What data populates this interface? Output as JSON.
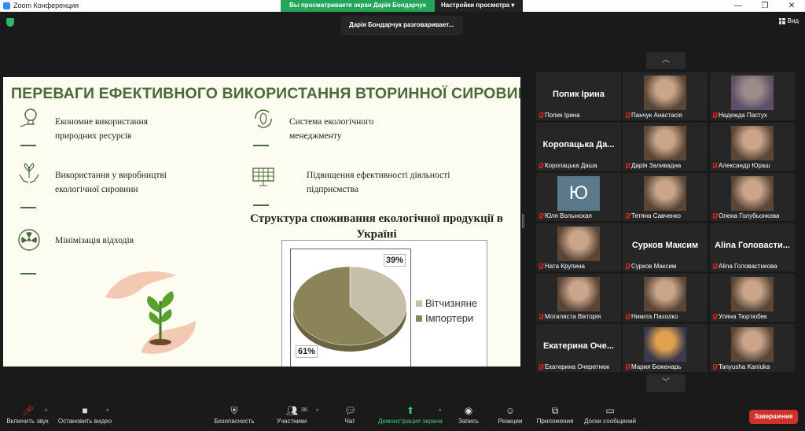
{
  "window": {
    "title": "Zoom Конференция",
    "controls": [
      "minimize",
      "maximize",
      "close"
    ]
  },
  "viewing_bar": {
    "viewing_text": "Вы просматриваете экран Дарія Бондарчук",
    "view_options": "Настройки просмотра"
  },
  "view_button": {
    "label": "Вид"
  },
  "tooltip": {
    "text": "Дарія Бондарчук разговаривает..."
  },
  "slide": {
    "title": "ПЕРЕВАГИ ЕФЕКТИВНОГО ВИКОРИСТАННЯ ВТОРИННОЇ СИРОВИНИ",
    "features_left": [
      {
        "icon": "lightbulb-icon",
        "text": "Економне використання природних ресурсів"
      },
      {
        "icon": "hands-plant-icon",
        "text": "Використання у виробництві екологічної сировини"
      },
      {
        "icon": "radiation-icon",
        "text": "Мінімізація відходів"
      }
    ],
    "features_right": [
      {
        "icon": "recycle-leaf-icon",
        "text": "Система екологічного менеджменту"
      },
      {
        "icon": "solar-panel-icon",
        "text": "Підвищення ефективності діяльності підприємства"
      }
    ],
    "chart_title": "Структура споживання екологічної продукції в Україні"
  },
  "chart_data": {
    "type": "pie",
    "title": "Структура споживання екологічної продукції в Україні",
    "categories": [
      "Вітчизняне",
      "Імпортери"
    ],
    "values": [
      39,
      61
    ],
    "labels": [
      "39%",
      "61%"
    ],
    "colors": [
      "#c5bfa9",
      "#8b8458"
    ],
    "legend": "right"
  },
  "gallery": {
    "up_icon": "chevron-up-icon",
    "down_icon": "chevron-down-icon",
    "tiles": [
      {
        "name": "Попик Ірина",
        "big": "Попик Ірина",
        "video": false
      },
      {
        "name": "Панчук Анастасія",
        "big": "",
        "video": true,
        "photo": "person-photo"
      },
      {
        "name": "Надежда Пастух",
        "big": "",
        "video": true,
        "photo": "building-photo"
      },
      {
        "name": "Коропацька Даша",
        "big": "Коропацька Да...",
        "video": false
      },
      {
        "name": "Дарія Заливадна",
        "big": "",
        "video": true,
        "photo": "person-photo"
      },
      {
        "name": "Александр Юраш",
        "big": "",
        "video": true,
        "photo": "person-photo"
      },
      {
        "name": "Юля Волынская",
        "big": "",
        "video": false,
        "avatar": "Ю"
      },
      {
        "name": "Тетяна Савченко",
        "big": "",
        "video": true,
        "photo": "person-photo"
      },
      {
        "name": "Олена Голубьонкова",
        "big": "",
        "video": true,
        "photo": "person-photo"
      },
      {
        "name": "Ната Крупина",
        "big": "",
        "video": true,
        "photo": "person-photo"
      },
      {
        "name": "Сурков Максим",
        "big": "Сурков Максим",
        "video": false
      },
      {
        "name": "Alina Головастикова",
        "big": "Alina Головасти...",
        "video": false
      },
      {
        "name": "Могилястa Вікторія",
        "big": "",
        "video": true,
        "photo": "person-photo"
      },
      {
        "name": "Никита Пахолко",
        "big": "",
        "video": true,
        "photo": "person-photo"
      },
      {
        "name": "Уляна Тюртюбек",
        "big": "",
        "video": true,
        "photo": "person-photo"
      },
      {
        "name": "Екатерина Очеретнюк",
        "big": "Екатерина Оче...",
        "video": false
      },
      {
        "name": "Мария Беженарь",
        "big": "",
        "video": true,
        "photo": "sunset-photo"
      },
      {
        "name": "Tanyusha Kaniuka",
        "big": "",
        "video": true,
        "photo": "person-photo"
      }
    ]
  },
  "toolbar": {
    "mute": "Включить звук",
    "video": "Остановить видео",
    "security": "Безопасность",
    "participants": "Участники",
    "participants_count": "38",
    "chat": "Чат",
    "share": "Демонстрация экрана",
    "record": "Запись",
    "reactions": "Реакции",
    "apps": "Приложения",
    "whiteboards": "Доски сообщений",
    "end": "Завершение"
  }
}
